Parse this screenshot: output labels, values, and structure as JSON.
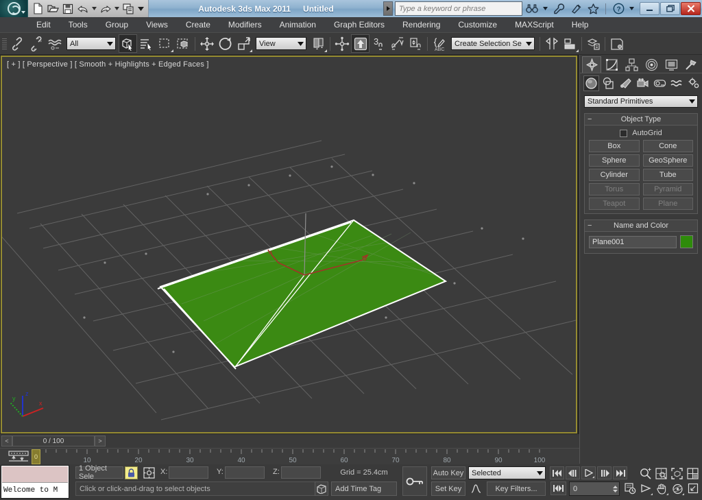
{
  "titlebar": {
    "app_name": "Autodesk 3ds Max  2011",
    "document_name": "Untitled",
    "logo_icon": "3dsmax-logo-icon",
    "quick_access": [
      {
        "name": "new-file-button",
        "icon": "new-file-icon"
      },
      {
        "name": "open-file-button",
        "icon": "open-folder-icon"
      },
      {
        "name": "save-file-button",
        "icon": "floppy-disk-icon"
      },
      {
        "name": "undo-button",
        "icon": "undo-arrow-icon"
      },
      {
        "name": "undo-dropdown",
        "icon": "chevron-down-icon"
      },
      {
        "name": "redo-button",
        "icon": "redo-arrow-icon"
      },
      {
        "name": "redo-dropdown",
        "icon": "chevron-down-icon"
      },
      {
        "name": "workspace-button",
        "icon": "windows-stack-icon"
      },
      {
        "name": "qat-dropdown",
        "icon": "chevron-down-icon"
      }
    ],
    "search": {
      "placeholder": "Type a keyword or phrase",
      "dropdown_icon": "caret-right-icon"
    },
    "right_icons": [
      {
        "name": "search-binoculars-button",
        "icon": "binoculars-icon"
      },
      {
        "name": "search-options-dropdown",
        "icon": "chevron-down-icon"
      },
      {
        "name": "subscription-wrench-button",
        "icon": "wrench-icon"
      },
      {
        "name": "communication-center-button",
        "icon": "satellite-dish-icon"
      },
      {
        "name": "favorites-button",
        "icon": "star-icon"
      },
      {
        "name": "help-button",
        "icon": "question-circle-icon"
      },
      {
        "name": "help-dropdown",
        "icon": "chevron-down-icon"
      }
    ],
    "window_controls": [
      {
        "name": "minimize-button",
        "icon": "minimize-icon"
      },
      {
        "name": "restore-button",
        "icon": "restore-icon"
      },
      {
        "name": "close-button",
        "icon": "close-x-icon"
      }
    ]
  },
  "menubar": {
    "items": [
      "Edit",
      "Tools",
      "Group",
      "Views",
      "Create",
      "Modifiers",
      "Animation",
      "Graph Editors",
      "Rendering",
      "Customize",
      "MAXScript",
      "Help"
    ]
  },
  "main_toolbar": {
    "selection_filter": {
      "value": "All"
    },
    "reference_coord_system": {
      "value": "View"
    },
    "named_selection_sets": {
      "placeholder": "Create Selection Se",
      "value": "Create Selection Se"
    },
    "buttons": [
      {
        "name": "select-and-link-button",
        "icon": "link-chain-icon"
      },
      {
        "name": "unlink-selection-button",
        "icon": "unlink-chain-icon"
      },
      {
        "name": "bind-to-space-warp-button",
        "icon": "space-warp-waves-icon"
      },
      {
        "name": "select-object-button",
        "icon": "select-arrow-cube-icon",
        "active": true
      },
      {
        "name": "select-by-name-button",
        "icon": "select-by-name-icon"
      },
      {
        "name": "rectangular-selection-region-button",
        "icon": "dashed-rectangle-icon"
      },
      {
        "name": "window-crossing-toggle-button",
        "icon": "window-crossing-icon"
      },
      {
        "name": "select-and-move-button",
        "icon": "four-way-move-arrows-icon"
      },
      {
        "name": "select-and-rotate-button",
        "icon": "rotate-circle-arrow-icon"
      },
      {
        "name": "select-and-scale-button",
        "icon": "scale-square-arrow-icon"
      },
      {
        "name": "use-center-flyout-button",
        "icon": "pivot-center-icon"
      },
      {
        "name": "select-and-manipulate-button",
        "icon": "manipulate-arrow-icon"
      },
      {
        "name": "snaps-toggle-button",
        "icon": "snaps-3-magnet-icon",
        "active": true
      },
      {
        "name": "angle-snap-toggle-button",
        "icon": "angle-snap-magnet-icon"
      },
      {
        "name": "percent-snap-toggle-button",
        "icon": "percent-snap-magnet-icon"
      },
      {
        "name": "spinner-snap-toggle-button",
        "icon": "spinner-snap-magnet-icon"
      },
      {
        "name": "edit-named-selection-sets-button",
        "icon": "named-selection-pencil-icon"
      },
      {
        "name": "mirror-button",
        "icon": "mirror-icon"
      },
      {
        "name": "align-flyout-button",
        "icon": "align-icon"
      },
      {
        "name": "layer-manager-button",
        "icon": "layers-icon"
      },
      {
        "name": "curve-editor-button",
        "icon": "curve-editor-icon"
      },
      {
        "name": "schematic-view-button",
        "icon": "schematic-view-icon"
      },
      {
        "name": "material-editor-button",
        "icon": "material-editor-spheres-icon"
      },
      {
        "name": "render-setup-button",
        "icon": "render-setup-teapot-icon"
      },
      {
        "name": "rendered-frame-window-button",
        "icon": "rendered-frame-icon"
      },
      {
        "name": "render-production-button",
        "icon": "render-teapot-icon"
      }
    ]
  },
  "viewport": {
    "label": "[ + ] [ Perspective ] [ Smooth + Highlights + Edged Faces ]",
    "background_color": "#3b3b3b",
    "active_border_color": "#958b31",
    "grid_color": "#6e6e6e",
    "object": {
      "name": "Plane001",
      "fill_color": "#3b8a13",
      "selection_bracket_color": "#ffffff",
      "gizmo_x_color": "#b22020",
      "gizmo_z_color": "#2233cc"
    },
    "axis_tripod": {
      "x_label": "x",
      "y_label": "y",
      "z_label": "z",
      "x_color": "#cc2222",
      "y_color": "#22aa22",
      "z_color": "#2233cc"
    }
  },
  "command_panel": {
    "tabs": [
      {
        "name": "tab-create",
        "icon": "create-star-icon",
        "selected": true
      },
      {
        "name": "tab-modify",
        "icon": "modify-curve-icon",
        "selected": false
      },
      {
        "name": "tab-hierarchy",
        "icon": "hierarchy-tree-icon",
        "selected": false
      },
      {
        "name": "tab-motion",
        "icon": "motion-wheel-icon",
        "selected": false
      },
      {
        "name": "tab-display",
        "icon": "display-monitor-icon",
        "selected": false
      },
      {
        "name": "tab-utilities",
        "icon": "utilities-hammer-icon",
        "selected": false
      }
    ],
    "categories": [
      {
        "name": "category-geometry",
        "icon": "geometry-sphere-icon",
        "selected": true
      },
      {
        "name": "category-shapes",
        "icon": "shapes-overlap-icon",
        "selected": false
      },
      {
        "name": "category-lights",
        "icon": "light-bulb-icon",
        "selected": false
      },
      {
        "name": "category-cameras",
        "icon": "camera-icon",
        "selected": false
      },
      {
        "name": "category-helpers",
        "icon": "helpers-tape-icon",
        "selected": false
      },
      {
        "name": "category-space-warps",
        "icon": "space-warp-waves-icon",
        "selected": false
      },
      {
        "name": "category-systems",
        "icon": "systems-gears-icon",
        "selected": false
      }
    ],
    "subcategory": {
      "value": "Standard Primitives"
    },
    "object_type": {
      "header": "Object Type",
      "autogrid_label": "AutoGrid",
      "autogrid_checked": false,
      "buttons": [
        {
          "label": "Box",
          "dim": false
        },
        {
          "label": "Cone",
          "dim": false
        },
        {
          "label": "Sphere",
          "dim": false
        },
        {
          "label": "GeoSphere",
          "dim": false
        },
        {
          "label": "Cylinder",
          "dim": false
        },
        {
          "label": "Tube",
          "dim": false
        },
        {
          "label": "Torus",
          "dim": true
        },
        {
          "label": "Pyramid",
          "dim": true
        },
        {
          "label": "Teapot",
          "dim": true
        },
        {
          "label": "Plane",
          "dim": true
        }
      ]
    },
    "name_and_color": {
      "header": "Name and Color",
      "name_value": "Plane001",
      "color": "#2e8b0a"
    }
  },
  "timeline": {
    "frame_display": "0 / 100",
    "prev_frame_label": "<",
    "next_frame_label": ">",
    "current_frame": "0",
    "ruler_labels": [
      "0",
      "10",
      "20",
      "30",
      "40",
      "50",
      "60",
      "70",
      "80",
      "90",
      "100"
    ],
    "range_start": 0,
    "range_end": 100,
    "key_mode_icon": "track-bar-key-icon"
  },
  "statusbar": {
    "message_log": "Welcome to M",
    "selection_count": "1 Object Sele",
    "lock_selection_icon": "padlock-icon",
    "transform_center_icon": "transform-center-icon",
    "coords": [
      {
        "label": "X:",
        "value": ""
      },
      {
        "label": "Y:",
        "value": ""
      },
      {
        "label": "Z:",
        "value": ""
      }
    ],
    "grid_info": "Grid = 25.4cm",
    "prompt": "Click or click-and-drag to select objects",
    "isolate_selection_icon": "isolate-cube-icon",
    "add_time_tag": "Add Time Tag",
    "key_toggle_icon": "key-icon",
    "auto_key_label": "Auto Key",
    "set_key_label": "Set Key",
    "filter_set": {
      "value": "Selected"
    },
    "key_filters_label": "Key Filters...",
    "curve_icon": "parameter-curve-icon",
    "playback": [
      {
        "name": "goto-start-button",
        "icon": "skip-to-start-icon"
      },
      {
        "name": "previous-frame-button",
        "icon": "step-back-icon"
      },
      {
        "name": "play-animation-button",
        "icon": "play-icon"
      },
      {
        "name": "next-frame-button",
        "icon": "step-forward-icon"
      },
      {
        "name": "goto-end-button",
        "icon": "skip-to-end-icon"
      }
    ],
    "key_step": [
      {
        "name": "key-mode-toggle-button",
        "icon": "key-mode-icon"
      }
    ],
    "nav_icons": [
      {
        "name": "zoom-button",
        "icon": "magnifier-plusminus-icon"
      },
      {
        "name": "zoom-all-button",
        "icon": "zoom-all-icon"
      },
      {
        "name": "zoom-extents-button",
        "icon": "zoom-extents-icon"
      },
      {
        "name": "zoom-region-button",
        "icon": "zoom-region-icon"
      },
      {
        "name": "time-configuration-button",
        "icon": "time-config-clock-icon"
      },
      {
        "name": "field-of-view-button",
        "icon": "field-of-view-icon"
      },
      {
        "name": "pan-view-button",
        "icon": "pan-hand-icon"
      },
      {
        "name": "orbit-button",
        "icon": "orbit-icon"
      },
      {
        "name": "maximize-viewport-toggle-button",
        "icon": "maximize-viewport-icon"
      }
    ]
  }
}
